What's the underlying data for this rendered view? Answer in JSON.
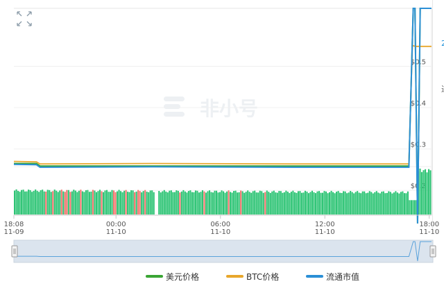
{
  "controls": {
    "expand_icon": "expand-arrows-icon"
  },
  "watermark": {
    "text": "非小号",
    "icon": "feixiaohao-logo-icon"
  },
  "chart_data": {
    "type": "line",
    "x_ticks": [
      {
        "time": "18:08",
        "date": "11-09"
      },
      {
        "time": "00:00",
        "date": "11-10"
      },
      {
        "time": "06:00",
        "date": "11-10"
      },
      {
        "time": "12:00",
        "date": "11-10"
      },
      {
        "time": "18:00",
        "date": "11-10"
      }
    ],
    "y_ticks": [
      "$0.2",
      "$0.3",
      "$0.4",
      "$0.5"
    ],
    "ylim": [
      0.14,
      0.64
    ],
    "x_start_hours": 0,
    "x_end_hours": 24,
    "series": [
      {
        "name": "美元价格",
        "color": "#3aa534",
        "points": [
          [
            0,
            0.265
          ],
          [
            1.3,
            0.265
          ],
          [
            1.5,
            0.259
          ],
          [
            22.7,
            0.259
          ],
          [
            22.95,
            0.64
          ],
          [
            23.05,
            0.64
          ],
          [
            23.2,
            0.12
          ],
          [
            23.35,
            0.64
          ],
          [
            24,
            0.64
          ]
        ]
      },
      {
        "name": "BTC价格",
        "color": "#e8a72c",
        "points": [
          [
            0,
            0.27
          ],
          [
            1.3,
            0.269
          ],
          [
            1.5,
            0.264
          ],
          [
            8,
            0.265
          ],
          [
            16,
            0.264
          ],
          [
            22.7,
            0.264
          ],
          [
            22.9,
            0.55
          ],
          [
            23.1,
            0.548
          ],
          [
            24,
            0.548
          ]
        ]
      },
      {
        "name": "流通市值",
        "color": "#2b8fd6",
        "points": [
          [
            0,
            0.263
          ],
          [
            1.3,
            0.262
          ],
          [
            1.5,
            0.256
          ],
          [
            8,
            0.257
          ],
          [
            16,
            0.256
          ],
          [
            22.7,
            0.256
          ],
          [
            22.95,
            0.64
          ],
          [
            23.05,
            0.64
          ],
          [
            23.2,
            0.12
          ],
          [
            23.35,
            0.64
          ],
          [
            24,
            0.64
          ]
        ]
      }
    ],
    "volume": {
      "colors": {
        "up": "#2ec475",
        "down": "#f2766f"
      },
      "bars_per_hour": 10,
      "base_level": 0.5,
      "gaps_hours": [
        [
          8.1,
          8.3
        ]
      ],
      "down_hours": [
        1.2,
        1.9,
        2.3,
        2.8,
        3.0,
        3.3,
        3.9,
        4.6,
        5.1,
        5.8,
        6.4,
        6.9,
        7.2,
        7.6,
        9.6,
        10.9,
        12.3,
        13.1,
        13.5,
        14.4
      ],
      "spike_from_hours": 23.2,
      "spike_level": 0.92
    },
    "grid": true
  },
  "navigator": {
    "handle_icons": [
      "left-drag-handle-icon",
      "right-drag-handle-icon"
    ]
  },
  "legend": [
    {
      "label": "美元价格",
      "color": "#3aa534"
    },
    {
      "label": "BTC价格",
      "color": "#e8a72c"
    },
    {
      "label": "流通市值",
      "color": "#2b8fd6"
    }
  ],
  "right_rail": {
    "glyph_top": "2",
    "glyph_bottom": "进"
  }
}
